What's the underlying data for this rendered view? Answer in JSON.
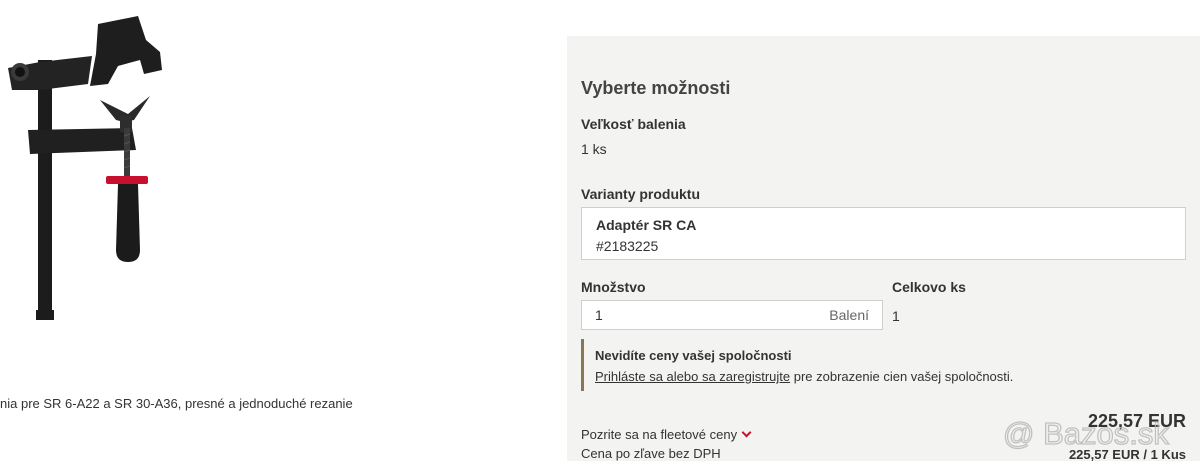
{
  "product": {
    "caption": "nia pre SR 6-A22 a SR 30-A36, presné a jednoduché rezanie"
  },
  "options": {
    "title": "Vyberte možnosti",
    "package_size_label": "Veľkosť balenia",
    "package_size_value": "1 ks",
    "variants_label": "Varianty produktu",
    "variant": {
      "name": "Adaptér SR CA",
      "code": "#2183225"
    },
    "quantity_label": "Množstvo",
    "quantity_value": "1",
    "quantity_unit": "Balení",
    "total_label": "Celkovo ks",
    "total_value": "1"
  },
  "notice": {
    "title": "Nevidíte ceny vašej spoločnosti",
    "link_text": "Prihláste sa alebo sa zaregistrujte",
    "text_after": " pre zobrazenie cien vašej spoločnosti."
  },
  "pricing": {
    "fleet_link": "Pozrite sa na fleetové ceny",
    "discount_label": "Cena po zľave bez DPH",
    "price": "225,57 EUR",
    "price_per_unit": "225,57 EUR / 1 Kus"
  },
  "watermark": {
    "text": "@ Bazos.sk"
  },
  "colors": {
    "panel_bg": "#f3f3f1",
    "accent_red": "#c8102e",
    "notice_border": "#8a7558",
    "clamp_black": "#1a1a1a"
  }
}
